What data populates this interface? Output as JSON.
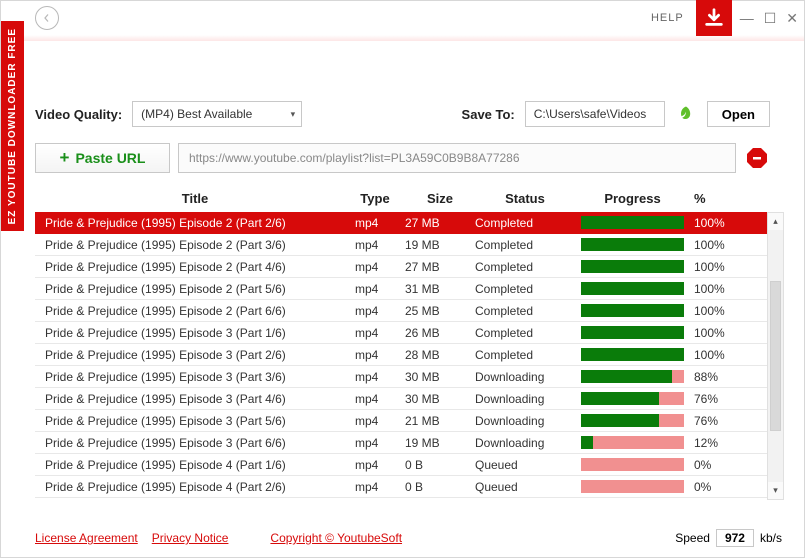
{
  "app_title": "EZ YOUTUBE DOWNLOADER FREE",
  "topbar": {
    "help": "HELP"
  },
  "controls": {
    "quality_label": "Video Quality:",
    "quality_value": "(MP4) Best Available",
    "saveto_label": "Save To:",
    "saveto_value": "C:\\Users\\safe\\Videos",
    "open_label": "Open"
  },
  "url": {
    "paste_label": "Paste URL",
    "value": "https://www.youtube.com/playlist?list=PL3A59C0B9B8A77286"
  },
  "columns": {
    "title": "Title",
    "type": "Type",
    "size": "Size",
    "status": "Status",
    "progress": "Progress",
    "pct": "%"
  },
  "rows": [
    {
      "title": "Pride & Prejudice (1995) Episode 2 (Part 2/6)",
      "type": "mp4",
      "size": "27 MB",
      "status": "Completed",
      "pct": 100,
      "pct_label": "100%",
      "selected": true
    },
    {
      "title": "Pride & Prejudice (1995) Episode 2 (Part 3/6)",
      "type": "mp4",
      "size": "19 MB",
      "status": "Completed",
      "pct": 100,
      "pct_label": "100%"
    },
    {
      "title": "Pride & Prejudice (1995) Episode 2 (Part 4/6)",
      "type": "mp4",
      "size": "27 MB",
      "status": "Completed",
      "pct": 100,
      "pct_label": "100%"
    },
    {
      "title": "Pride & Prejudice (1995) Episode 2 (Part 5/6)",
      "type": "mp4",
      "size": "31 MB",
      "status": "Completed",
      "pct": 100,
      "pct_label": "100%"
    },
    {
      "title": "Pride & Prejudice (1995) Episode 2 (Part 6/6)",
      "type": "mp4",
      "size": "25 MB",
      "status": "Completed",
      "pct": 100,
      "pct_label": "100%"
    },
    {
      "title": "Pride & Prejudice (1995) Episode 3 (Part 1/6)",
      "type": "mp4",
      "size": "26 MB",
      "status": "Completed",
      "pct": 100,
      "pct_label": "100%"
    },
    {
      "title": "Pride & Prejudice (1995) Episode 3 (Part 2/6)",
      "type": "mp4",
      "size": "28 MB",
      "status": "Completed",
      "pct": 100,
      "pct_label": "100%"
    },
    {
      "title": "Pride & Prejudice (1995) Episode 3 (Part 3/6)",
      "type": "mp4",
      "size": "30 MB",
      "status": "Downloading",
      "pct": 88,
      "pct_label": "88%"
    },
    {
      "title": "Pride & Prejudice (1995) Episode 3 (Part 4/6)",
      "type": "mp4",
      "size": "30 MB",
      "status": "Downloading",
      "pct": 76,
      "pct_label": "76%"
    },
    {
      "title": "Pride & Prejudice (1995) Episode 3 (Part 5/6)",
      "type": "mp4",
      "size": "21 MB",
      "status": "Downloading",
      "pct": 76,
      "pct_label": "76%"
    },
    {
      "title": "Pride & Prejudice (1995) Episode 3 (Part 6/6)",
      "type": "mp4",
      "size": "19 MB",
      "status": "Downloading",
      "pct": 12,
      "pct_label": "12%"
    },
    {
      "title": "Pride & Prejudice (1995) Episode 4 (Part 1/6)",
      "type": "mp4",
      "size": "0 B",
      "status": "Queued",
      "pct": 0,
      "pct_label": "0%"
    },
    {
      "title": "Pride & Prejudice (1995) Episode 4 (Part 2/6)",
      "type": "mp4",
      "size": "0 B",
      "status": "Queued",
      "pct": 0,
      "pct_label": "0%"
    }
  ],
  "footer": {
    "license": "License Agreement",
    "privacy": "Privacy Notice",
    "copyright": "Copyright © YoutubeSoft",
    "speed_label": "Speed",
    "speed_value": "972",
    "speed_unit": "kb/s"
  }
}
